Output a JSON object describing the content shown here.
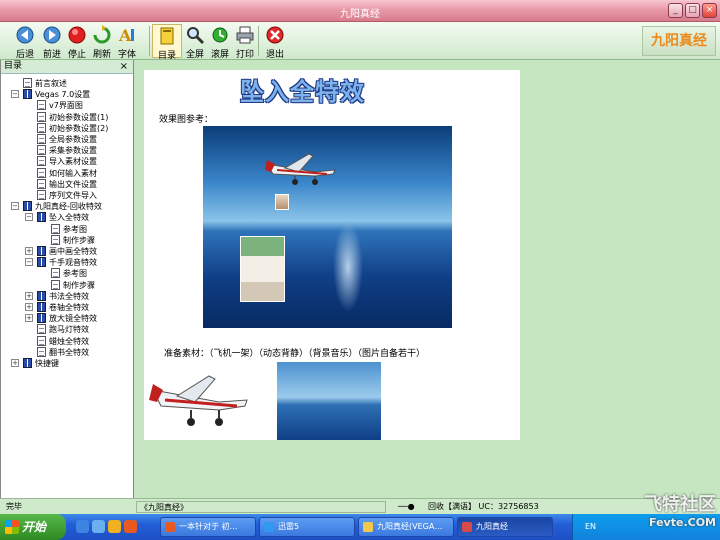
{
  "window": {
    "title": "九阳真经"
  },
  "toolbar": {
    "items": [
      {
        "id": "back",
        "label": "后退"
      },
      {
        "id": "forward",
        "label": "前进"
      },
      {
        "id": "stop",
        "label": "停止"
      },
      {
        "id": "refresh",
        "label": "刷新"
      },
      {
        "id": "font",
        "label": "字体"
      },
      {
        "id": "toc",
        "label": "目录"
      },
      {
        "id": "fullscreen",
        "label": "全屏"
      },
      {
        "id": "wave",
        "label": "滚屏"
      },
      {
        "id": "print",
        "label": "打印"
      },
      {
        "id": "exit",
        "label": "退出"
      }
    ],
    "brand": "九阳真经"
  },
  "sidebar": {
    "title": "目录",
    "tree": [
      {
        "label": "前言叙述",
        "level": 1,
        "icon": "page",
        "expander": ""
      },
      {
        "label": "Vegas 7.0设置",
        "level": 1,
        "icon": "book",
        "expander": "−"
      },
      {
        "label": "v7界面图",
        "level": 2,
        "icon": "page",
        "expander": ""
      },
      {
        "label": "初始参数设置(1)",
        "level": 2,
        "icon": "page",
        "expander": ""
      },
      {
        "label": "初始参数设置(2)",
        "level": 2,
        "icon": "page",
        "expander": ""
      },
      {
        "label": "全局参数设置",
        "level": 2,
        "icon": "page",
        "expander": ""
      },
      {
        "label": "采集参数设置",
        "level": 2,
        "icon": "page",
        "expander": ""
      },
      {
        "label": "导入素材设置",
        "level": 2,
        "icon": "page",
        "expander": ""
      },
      {
        "label": "如何输入素材",
        "level": 2,
        "icon": "page",
        "expander": ""
      },
      {
        "label": "输出文件设置",
        "level": 2,
        "icon": "page",
        "expander": ""
      },
      {
        "label": "序列文件导入",
        "level": 2,
        "icon": "page",
        "expander": ""
      },
      {
        "label": "九阳真经-回收特效",
        "level": 1,
        "icon": "book",
        "expander": "−"
      },
      {
        "label": "坠入全特效",
        "level": 2,
        "icon": "book",
        "expander": "−"
      },
      {
        "label": "参考图",
        "level": 3,
        "icon": "page",
        "expander": ""
      },
      {
        "label": "制作步骤",
        "level": 3,
        "icon": "page",
        "expander": ""
      },
      {
        "label": "画中画全特效",
        "level": 2,
        "icon": "book",
        "expander": "+"
      },
      {
        "label": "千手观音特效",
        "level": 2,
        "icon": "book",
        "expander": "−"
      },
      {
        "label": "参考图",
        "level": 3,
        "icon": "page",
        "expander": ""
      },
      {
        "label": "制作步骤",
        "level": 3,
        "icon": "page",
        "expander": ""
      },
      {
        "label": "书法全特效",
        "level": 2,
        "icon": "book",
        "expander": "+"
      },
      {
        "label": "卷轴全特效",
        "level": 2,
        "icon": "book",
        "expander": "+"
      },
      {
        "label": "放大镜全特效",
        "level": 2,
        "icon": "book",
        "expander": "+"
      },
      {
        "label": "跑马灯特效",
        "level": 2,
        "icon": "page",
        "expander": ""
      },
      {
        "label": "蜡烛全特效",
        "level": 2,
        "icon": "page",
        "expander": ""
      },
      {
        "label": "翻书全特效",
        "level": 2,
        "icon": "page",
        "expander": ""
      },
      {
        "label": "快捷键",
        "level": 1,
        "icon": "book",
        "expander": "+"
      }
    ]
  },
  "content": {
    "heading": "坠入全特效",
    "reference_label": "效果图参考：",
    "materials_label": "准备素材：（飞机一架）（动态背静）（背景音乐）（图片自备若干）"
  },
  "statusbar": {
    "left": "完毕",
    "doc": "《九阳真经》",
    "right": "回收【满语】 UC：32756853"
  },
  "taskbar": {
    "start": "开始",
    "tasks": [
      {
        "label": "一本针对于 初…"
      },
      {
        "label": "迅雷5"
      },
      {
        "label": "九阳真经(VEGA…"
      },
      {
        "label": "九阳真经"
      }
    ],
    "tray_lang": "EN"
  },
  "watermark": {
    "title": "飞特社区",
    "sub": "Fevte.COM"
  },
  "colors": {
    "titlebar": "#e89aa8",
    "toolbar": "#cfe9cb",
    "workspace": "#c5e6c0",
    "taskbar": "#235ed8",
    "brand": "#ee8a1b"
  }
}
